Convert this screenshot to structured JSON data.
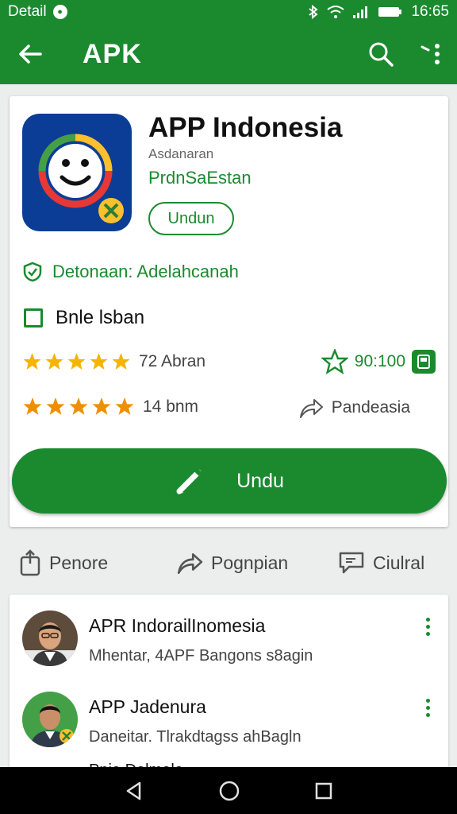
{
  "status_bar": {
    "carrier": "Detail",
    "time": "16:65"
  },
  "app_bar": {
    "title": "APK"
  },
  "app": {
    "name": "APP Indonesia",
    "developer": "Asdanaran",
    "category": "PrdnSaEstan",
    "install_pill": "Undun",
    "verified": "Detonaan: Adelahcanah",
    "checkbox_label": "Bnle lsban",
    "rating_primary": "72 Abran",
    "rating_secondary": "14 bnm",
    "score": "90:100",
    "share_label": "Pandeasia",
    "main_button": "Undu"
  },
  "actions": [
    {
      "label": "Penore",
      "icon": "share-box-icon"
    },
    {
      "label": "Pognpian",
      "icon": "forward-icon"
    },
    {
      "label": "Ciulral",
      "icon": "chat-icon"
    }
  ],
  "reviews": [
    {
      "name": "APR  IndorailInomesia",
      "subtitle": "Mhentar, 4APF Bangons s8agin"
    },
    {
      "name": "APP Jadenura",
      "subtitle": "Daneitar. Tlrakdtagss ahBagln"
    }
  ],
  "reviews_cut_text": "Pnie Dalmale",
  "colors": {
    "primary": "#1b8a2f",
    "star": "#f5b400",
    "icon_bg": "#0b3d96"
  }
}
